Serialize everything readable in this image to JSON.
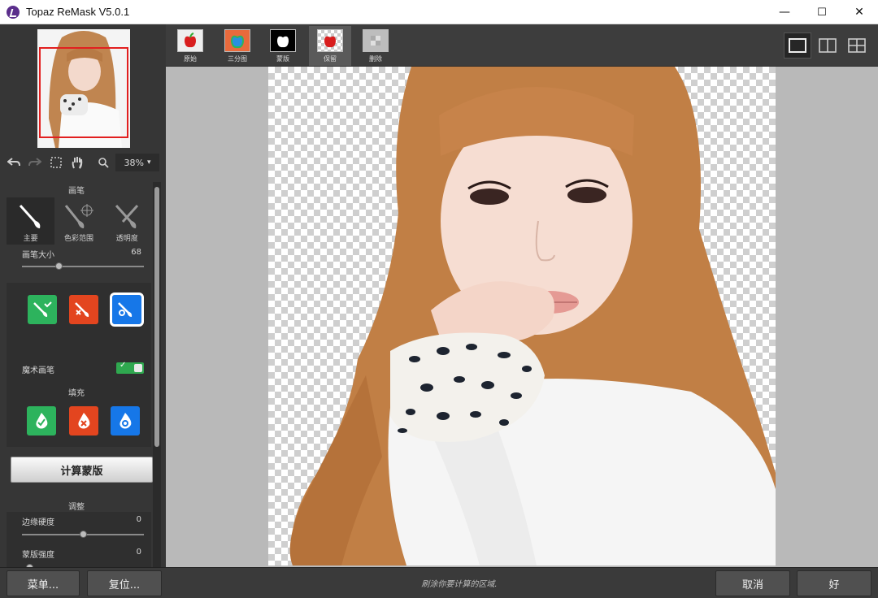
{
  "window": {
    "title": "Topaz ReMask V5.0.1",
    "minimize": "—",
    "maximize": "☐",
    "close": "✕"
  },
  "left_panel": {
    "zoom": {
      "value": "38%",
      "arrow": "▾"
    },
    "brush_section": {
      "title": "画笔",
      "tabs": [
        {
          "label": "主要",
          "active": true
        },
        {
          "label": "色彩范围",
          "active": false
        },
        {
          "label": "透明度",
          "active": false
        }
      ],
      "size_label": "画笔大小",
      "size_value": "68",
      "size_level": 0.3,
      "magic_brush_label": "魔术画笔",
      "magic_brush_on": true,
      "colors": {
        "keep": "#2db35d",
        "cut": "#e3451f",
        "compute": "#1677e8"
      }
    },
    "fill_section": {
      "title": "填充"
    },
    "compute_button": "计算蒙版",
    "adjust_section": {
      "title": "调整",
      "edge_label": "边缘硬度",
      "edge_value": "0",
      "edge_level": 0.5,
      "mask_label": "蒙版强度",
      "mask_value": "0"
    }
  },
  "mode_bar": {
    "modes": [
      {
        "label": "原始",
        "icon": "red-apple-icon"
      },
      {
        "label": "三分图",
        "icon": "tri-apple-icon"
      },
      {
        "label": "蒙版",
        "icon": "white-apple-icon"
      },
      {
        "label": "保留",
        "icon": "red-apple-checker-icon",
        "active": true
      },
      {
        "label": "删除",
        "icon": "checker-icon"
      }
    ]
  },
  "bottom_bar": {
    "menu_button": "菜单...",
    "reset_button": "复位...",
    "status": "刷涂你要计算的区域.",
    "cancel_button": "取消",
    "ok_button": "好"
  }
}
